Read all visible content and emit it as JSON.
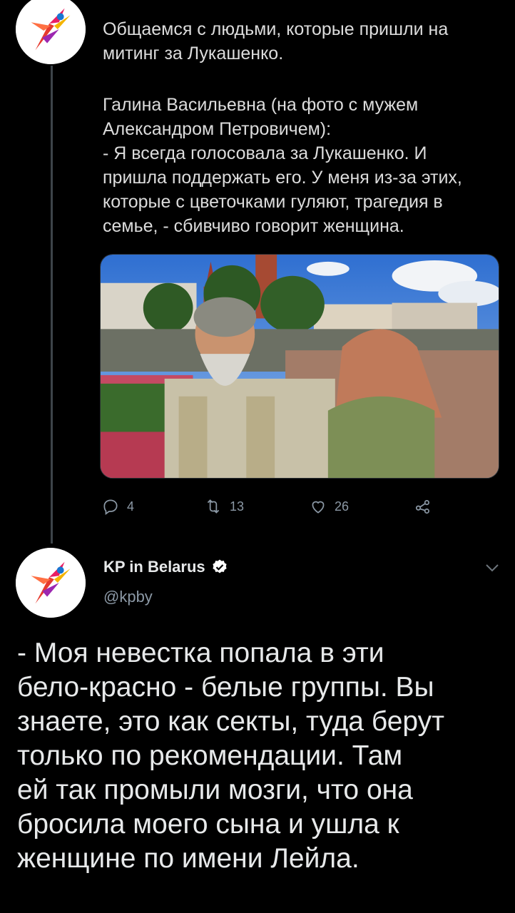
{
  "thread_tweet": {
    "text_line1": "Общаемся с людьми, которые пришли на",
    "text_line2": "митинг за Лукашенко.",
    "para2": [
      "Галина Васильевна (на фото с мужем",
      "Александром Петровичем):",
      "- Я всегда голосовала за Лукашенко. И",
      "пришла поддержать его. У меня из-за этих,",
      "которые с цветочками гуляют, трагедия в",
      "семье, - сбивчиво говорит женщина."
    ],
    "actions": {
      "reply_count": "4",
      "retweet_count": "13",
      "like_count": "26"
    }
  },
  "main_tweet": {
    "author_name": "KP in Belarus",
    "handle": "@kpby",
    "lines": [
      "- Моя невестка попала в эти",
      "бело-красно - белые группы. Вы",
      "знаете, это как секты, туда берут",
      "только по рекомендации. Там",
      "ей так промыли мозги, что она",
      "бросила моего сына и ушла к",
      "женщине по имени Лейла."
    ]
  },
  "colors": {
    "background": "#000000",
    "text": "#e7e9ea",
    "muted": "#8b98a5",
    "verified": "#ffffff"
  },
  "icons": [
    "reply-icon",
    "retweet-icon",
    "like-icon",
    "share-icon",
    "verified-icon",
    "chevron-down-icon"
  ]
}
